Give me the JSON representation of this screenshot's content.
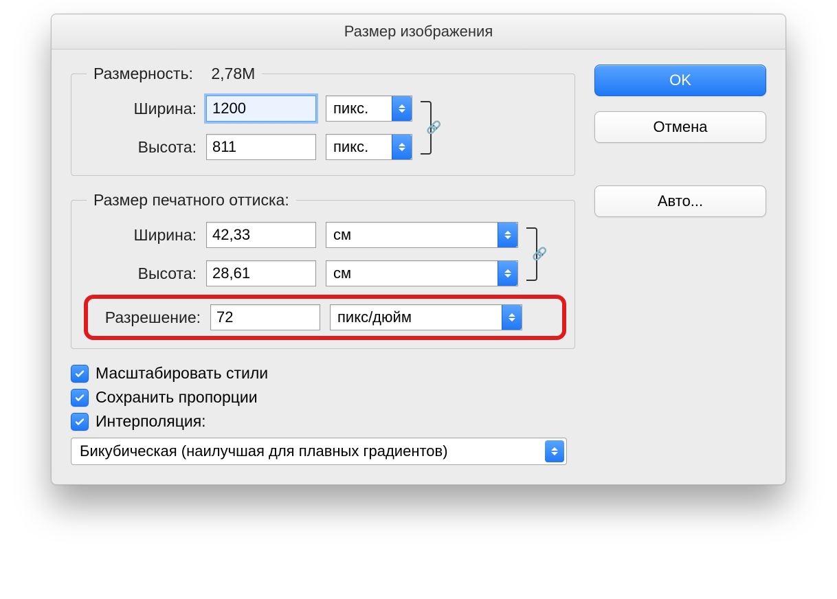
{
  "window": {
    "title": "Размер изображения"
  },
  "buttons": {
    "ok": "OK",
    "cancel": "Отмена",
    "auto": "Авто..."
  },
  "pixel_dim": {
    "legend": "Размерность:",
    "size": "2,78M",
    "width_label": "Ширина:",
    "width_value": "1200",
    "width_unit": "пикс.",
    "height_label": "Высота:",
    "height_value": "811",
    "height_unit": "пикс."
  },
  "doc_size": {
    "legend": "Размер печатного оттиска:",
    "width_label": "Ширина:",
    "width_value": "42,33",
    "width_unit": "см",
    "height_label": "Высота:",
    "height_value": "28,61",
    "height_unit": "см",
    "res_label": "Разрешение:",
    "res_value": "72",
    "res_unit": "пикс/дюйм"
  },
  "checks": {
    "scale_styles": "Масштабировать стили",
    "constrain": "Сохранить пропорции",
    "resample": "Интерполяция:"
  },
  "interpolation": {
    "selected": "Бикубическая (наилучшая для плавных градиентов)"
  },
  "icons": {
    "link": "🔗"
  }
}
